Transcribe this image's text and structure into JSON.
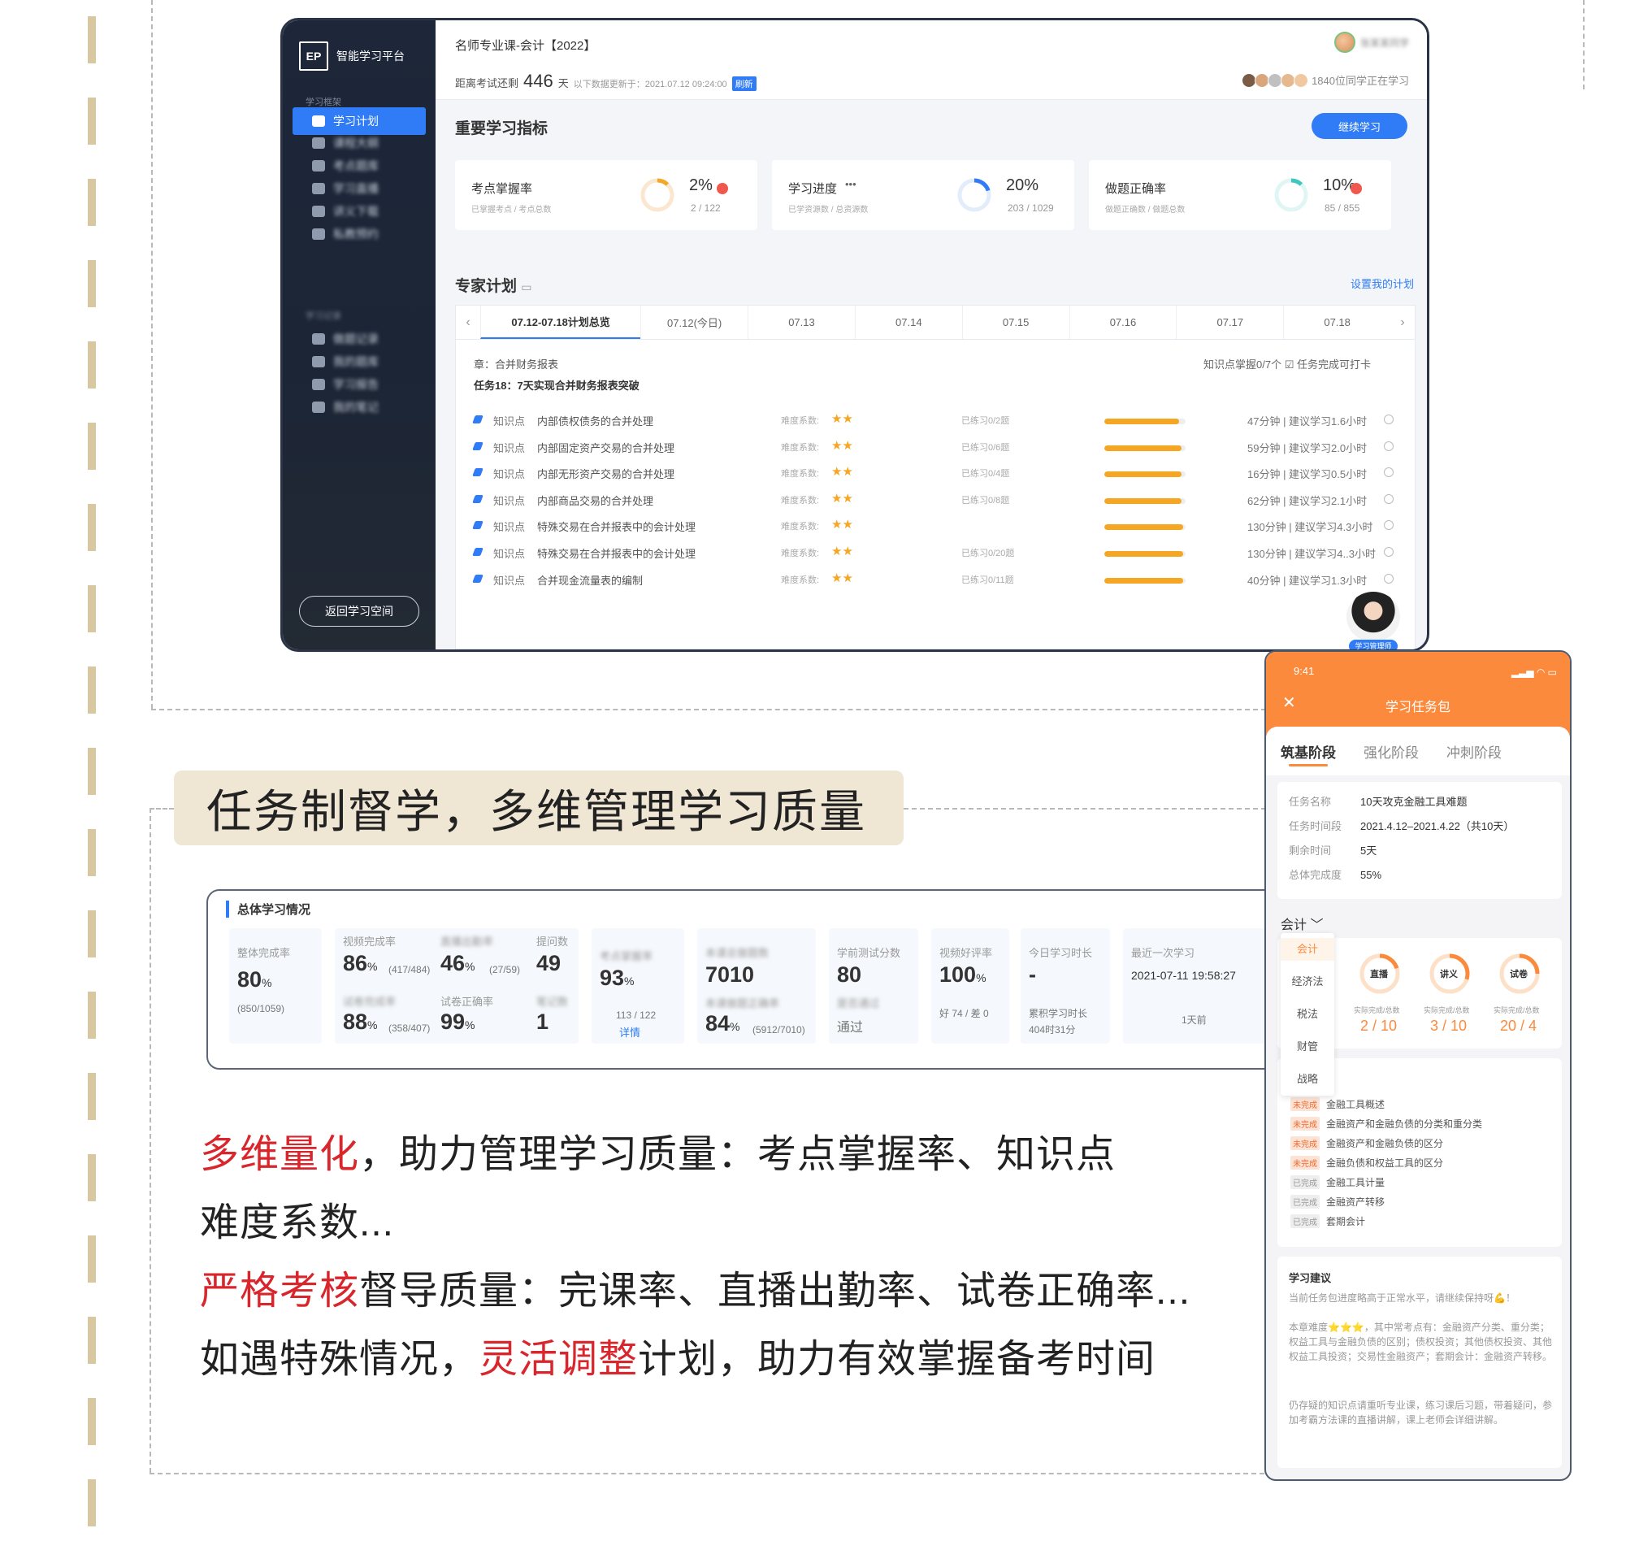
{
  "desktop": {
    "logo_mark": "EP",
    "logo_text": "智能学习平台",
    "sidebar": {
      "section1": "学习框架",
      "items": [
        {
          "label": "学习计划",
          "active": true
        },
        {
          "label": "课程大纲",
          "blurred": true
        },
        {
          "label": "考点题库",
          "blurred": true
        },
        {
          "label": "学习直播",
          "blurred": true
        },
        {
          "label": "讲义下载",
          "blurred": true
        },
        {
          "label": "私教预约",
          "blurred": true
        }
      ],
      "section2": "学习记录",
      "items2": [
        {
          "label": "做题记录",
          "blurred": true
        },
        {
          "label": "我的题库",
          "blurred": true
        },
        {
          "label": "学习报告",
          "blurred": true
        },
        {
          "label": "我的笔记",
          "blurred": true
        }
      ],
      "back_label": "返回学习空间"
    },
    "course_title": "名师专业课-会计【2022】",
    "exam_prefix": "距离考试还剩",
    "exam_days": "446",
    "exam_unit": "天",
    "exam_updated": "以下数据更新于：2021.07.12 09:24:00",
    "refresh_label": "刷新",
    "user_name": "张某某同学",
    "learners": "1840位同学正在学习",
    "metrics_title": "重要学习指标",
    "continue_label": "继续学习",
    "metrics": [
      {
        "title": "考点掌握率",
        "sub": "已掌握考点 / 考点总数",
        "pct": "2%",
        "count": "2 / 122",
        "value": 0.02,
        "color": "#f5a623",
        "alert": true
      },
      {
        "title": "学习进度",
        "sub": "已学资源数 / 总资源数",
        "pct": "20%",
        "count": "203 / 1029",
        "value": 0.2,
        "color": "#2f7cf6",
        "alert": false,
        "dots": "•••"
      },
      {
        "title": "做题正确率",
        "sub": "做题正确数 / 做题总数",
        "pct": "10%",
        "count": "85 / 855",
        "value": 0.1,
        "color": "#3cc8c0",
        "alert": true
      }
    ],
    "plan_title": "专家计划",
    "plan_link": "设置我的计划",
    "dates": [
      "07.12-07.18计划总览",
      "07.12(今日)",
      "07.13",
      "07.14",
      "07.15",
      "07.16",
      "07.17",
      "07.18"
    ],
    "chapter": "章：合并财务报表",
    "task": "任务18：7天实现合并财务报表突破",
    "plan_right": "知识点掌握0/7个   ☑ 任务完成可打卡",
    "difficulty_label": "难度系数:",
    "kp_label": "知识点",
    "knowledge": [
      {
        "name": "内部债权债务的合并处理",
        "stars": "★★",
        "practice": "已练习0/2题",
        "progress": 0.92,
        "time": "47分钟 | 建议学习1.6小时"
      },
      {
        "name": "内部固定资产交易的合并处理",
        "stars": "★★",
        "practice": "已练习0/6题",
        "progress": 0.95,
        "time": "59分钟 | 建议学习2.0小时"
      },
      {
        "name": "内部无形资产交易的合并处理",
        "stars": "★★",
        "practice": "已练习0/4题",
        "progress": 0.95,
        "time": "16分钟 | 建议学习0.5小时"
      },
      {
        "name": "内部商品交易的合并处理",
        "stars": "★★",
        "practice": "已练习0/8题",
        "progress": 0.95,
        "time": "62分钟 | 建议学习2.1小时"
      },
      {
        "name": "特殊交易在合并报表中的会计处理",
        "stars": "★★",
        "practice": "",
        "progress": 0.97,
        "time": "130分钟 | 建议学习4.3小时"
      },
      {
        "name": "特殊交易在合并报表中的会计处理",
        "stars": "★★",
        "practice": "已练习0/20题",
        "progress": 0.97,
        "time": "130分钟 | 建议学习4..3小时"
      },
      {
        "name": "合并现金流量表的编制",
        "stars": "★★",
        "practice": "已练习0/11题",
        "progress": 0.97,
        "time": "40分钟 | 建议学习1.3小时"
      }
    ],
    "tutor_tag": "学习管理师"
  },
  "slogan": "任务制督学，多维管理学习质量",
  "stats": {
    "title": "总体学习情况",
    "overall": {
      "label": "整体完成率",
      "value": "80",
      "unit": "%",
      "sub": "(850/1059)"
    },
    "video_rate": {
      "label": "视频完成率",
      "value": "86",
      "unit": "%",
      "sub": "(417/484)"
    },
    "live_rate": {
      "label": "直播出勤率",
      "value": "46",
      "unit": "%",
      "sub": "(27/59)"
    },
    "questions": {
      "label": "提问数",
      "value": "49"
    },
    "exam_rate": {
      "label": "试卷完成率",
      "value": "88",
      "unit": "%",
      "sub": "(358/407)"
    },
    "exam_correct": {
      "label": "试卷正确率",
      "value": "99",
      "unit": "%"
    },
    "notes": {
      "label": "笔记数",
      "value": "1"
    },
    "mastery": {
      "label": "考点掌握率",
      "value": "93",
      "unit": "%",
      "sub": "113 / 122",
      "link": "详情"
    },
    "done_count": {
      "label": "本课总做题数",
      "value": "7010",
      "label2": "本课做题正确率",
      "value2": "84",
      "unit2": "%",
      "sub2": "(5912/7010)"
    },
    "test_score": {
      "label": "学前测试分数",
      "value": "80",
      "label2": "是否通过",
      "value2": "通过"
    },
    "video_good": {
      "label": "视频好评率",
      "value": "100",
      "unit": "%",
      "sub": "好 74 / 差 0"
    },
    "today_time": {
      "label": "今日学习时长",
      "value": "-",
      "sub": "累积学习时长",
      "sub2": "404时31分"
    },
    "last_study": {
      "label": "最近一次学习",
      "value": "2021-07-11 19:58:27",
      "sub": "1天前"
    }
  },
  "body": {
    "line1_red": "多维量化",
    "line1_rest": "，助力管理学习质量：考点掌握率、知识点",
    "line2": "难度系数...",
    "line3_red": "严格考核",
    "line3_rest": "督导质量：完课率、直播出勤率、试卷正确率...",
    "line4_a": "如遇特殊情况，",
    "line4_red": "灵活调整",
    "line4_b": "计划，助力有效掌握备考时间"
  },
  "phone": {
    "time": "9:41",
    "title": "学习任务包",
    "tabs": [
      "筑基阶段",
      "强化阶段",
      "冲刺阶段"
    ],
    "info": [
      {
        "k": "任务名称",
        "v": "10天攻克金融工具难题"
      },
      {
        "k": "任务时间段",
        "v": "2021.4.12–2021.4.22（共10天）"
      },
      {
        "k": "剩余时间",
        "v": "5天"
      },
      {
        "k": "总体完成度",
        "v": "55%"
      }
    ],
    "subject": "会计 ﹀",
    "subjects": [
      "会计",
      "经济法",
      "税法",
      "财管",
      "战略"
    ],
    "rings": [
      {
        "label": "直播",
        "sub": "实际完成/总数",
        "val": "2 / 10",
        "value": 0.2
      },
      {
        "label": "讲义",
        "sub": "实际完成/总数",
        "val": "3 / 10",
        "value": 0.3
      },
      {
        "label": "试卷",
        "sub": "实际完成/总数",
        "val": "20 / 4",
        "value": 0.25
      }
    ],
    "chapters": [
      {
        "tag": "未完成",
        "done": false,
        "name": "金融工具概述"
      },
      {
        "tag": "未完成",
        "done": false,
        "name": "金融资产和金融负债的分类和重分类"
      },
      {
        "tag": "未完成",
        "done": false,
        "name": "金融资产和金融负债的区分"
      },
      {
        "tag": "未完成",
        "done": false,
        "name": "金融负债和权益工具的区分"
      },
      {
        "tag": "已完成",
        "done": true,
        "name": "金融工具计量"
      },
      {
        "tag": "已完成",
        "done": true,
        "name": "金融资产转移"
      },
      {
        "tag": "已完成",
        "done": true,
        "name": "套期会计"
      }
    ],
    "advice_title": "学习建议",
    "advice1": "当前任务包进度略高于正常水平，请继续保持呀💪！",
    "advice2": "本章难度⭐⭐⭐，其中常考点有：金融资产分类、重分类；权益工具与金融负债的区别；债权投资；其他债权投资、其他权益工具投资；交易性金融资产；套期会计：金融资产转移。",
    "advice3": "仍存疑的知识点请重听专业课，练习课后习题，带着疑问，参加考霸方法课的直播讲解，课上老师会详细讲解。"
  }
}
